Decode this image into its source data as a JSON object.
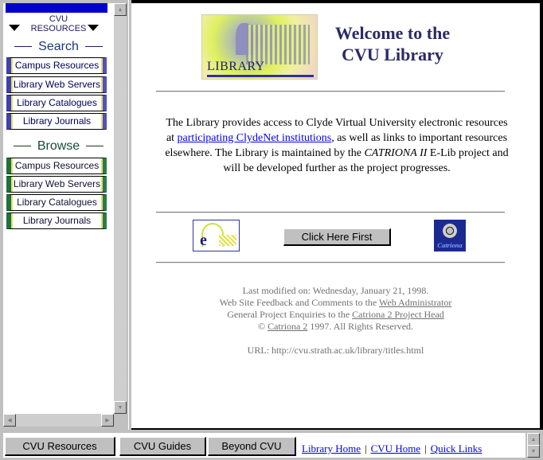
{
  "sidebar": {
    "header_line1": "CVU",
    "header_line2": "RESOURCES",
    "search": {
      "heading": "Search",
      "items": [
        {
          "label": "Campus Resources"
        },
        {
          "label": "Library Web Servers"
        },
        {
          "label": "Library Catalogues"
        },
        {
          "label": "Library Journals"
        }
      ]
    },
    "browse": {
      "heading": "Browse",
      "items": [
        {
          "label": "Campus Resources"
        },
        {
          "label": "Library Web Servers"
        },
        {
          "label": "Library Catalogues"
        },
        {
          "label": "Library Journals"
        }
      ]
    }
  },
  "main": {
    "logo_text": "LIBRARY",
    "title_line1": "Welcome to the",
    "title_line2": "CVU Library",
    "intro": {
      "part1": "The Library provides access to Clyde Virtual University electronic resources at ",
      "link": "participating ClydeNet institutions",
      "part2": ", as well as links to important resources elsewhere. The Library is maintained by the ",
      "italic": "CATRIONA II",
      "part3": " E-Lib project and will be developed further as the project progresses."
    },
    "elib_logo_text": "eLib",
    "click_first_label": "Click Here First",
    "catriona_logo_text": "Catriona",
    "footer": {
      "last_modified": "Last modified on: Wednesday, January 21, 1998.",
      "feedback_prefix": "Web Site Feedback and Comments to the ",
      "feedback_link": "Web Administrator",
      "enquiries_prefix": "General Project Enquiries to the ",
      "enquiries_link": "Catriona 2 Project Head",
      "copyright_symbol": "©",
      "copyright_link": "Catriona 2",
      "copyright_suffix": " 1997. All Rights Reserved.",
      "url": "URL: http://cvu.strath.ac.uk/library/titles.html"
    }
  },
  "bottom_nav": {
    "buttons": [
      {
        "label": "CVU Resources"
      },
      {
        "label": "CVU Guides"
      },
      {
        "label": "Beyond CVU"
      }
    ],
    "links": [
      {
        "label": "Library Home"
      },
      {
        "label": "CVU Home"
      },
      {
        "label": "Quick Links"
      }
    ],
    "separator": "|"
  },
  "colors": {
    "link": "#0000ee",
    "title": "#2a2a66",
    "footer_text": "#707070",
    "sidebar_top_bar": "#0000cc"
  }
}
